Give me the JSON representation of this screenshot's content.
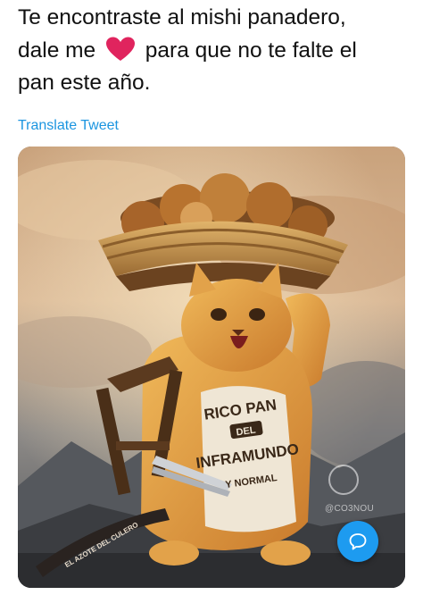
{
  "tweet": {
    "line1": "Te encontraste al mishi panadero,",
    "line2_before": "dale me",
    "line2_after": "para que no te falte el",
    "line3": "pan este año.",
    "heart_icon": "heart-icon",
    "heart_color": "#e0245e"
  },
  "translate": {
    "label": "Translate Tweet",
    "color": "#1b95e0"
  },
  "media": {
    "apron_text": [
      "RICO PAN",
      "DEL",
      "INFRAMUNDO",
      "Y NORMAL"
    ],
    "banner_text": "EL AZOTE DEL CULERO",
    "artist_handle": "@CO3NOU"
  },
  "reply_button": {
    "icon": "speech-bubble-icon",
    "color": "#1d9bf0"
  }
}
